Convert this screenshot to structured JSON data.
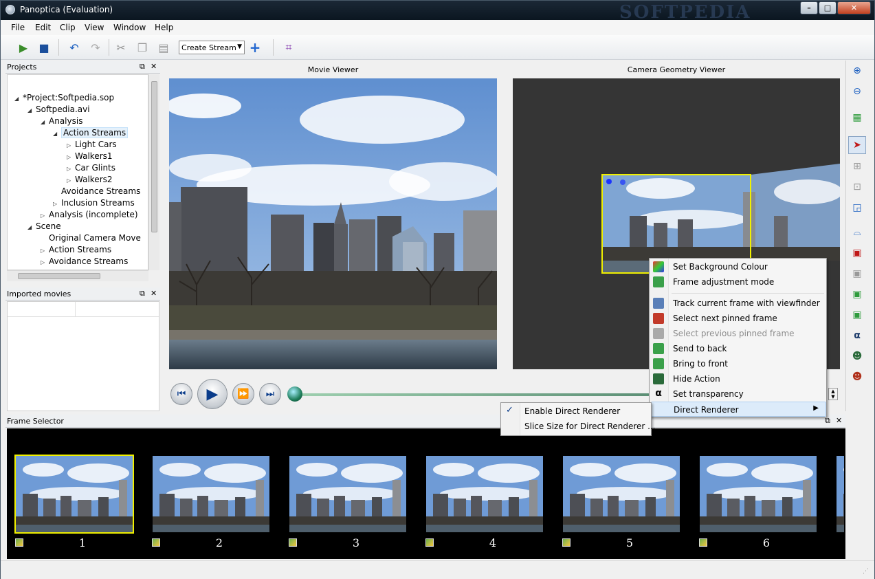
{
  "window": {
    "title": "Panoptica (Evaluation)",
    "watermark": "SOFTPEDIA",
    "min": "–",
    "max": "□",
    "close": "✕"
  },
  "menu": [
    "File",
    "Edit",
    "Clip",
    "View",
    "Window",
    "Help"
  ],
  "toolbar": {
    "stream_select": "Create Stream"
  },
  "projects": {
    "title": "Projects",
    "tree": [
      {
        "label": "*Project:Softpedia.sop",
        "depth": 0,
        "twisty": "◢"
      },
      {
        "label": "Softpedia.avi",
        "depth": 1,
        "twisty": "◢"
      },
      {
        "label": "Analysis",
        "depth": 2,
        "twisty": "◢"
      },
      {
        "label": "Action Streams",
        "depth": 3,
        "twisty": "◢",
        "selected": true
      },
      {
        "label": "Light Cars",
        "depth": 4,
        "twisty": "▷"
      },
      {
        "label": "Walkers1",
        "depth": 4,
        "twisty": "▷"
      },
      {
        "label": "Car Glints",
        "depth": 4,
        "twisty": "▷"
      },
      {
        "label": "Walkers2",
        "depth": 4,
        "twisty": "▷"
      },
      {
        "label": "Avoidance Streams",
        "depth": 3,
        "twisty": ""
      },
      {
        "label": "Inclusion Streams",
        "depth": 3,
        "twisty": "▷"
      },
      {
        "label": "Analysis (incomplete)",
        "depth": 2,
        "twisty": "▷"
      },
      {
        "label": "Scene",
        "depth": 1,
        "twisty": "◢"
      },
      {
        "label": "Original Camera Move",
        "depth": 2,
        "twisty": ""
      },
      {
        "label": "Action Streams",
        "depth": 2,
        "twisty": "▷"
      },
      {
        "label": "Avoidance Streams",
        "depth": 2,
        "twisty": "▷"
      }
    ]
  },
  "imported": {
    "title": "Imported movies"
  },
  "movie_viewer": {
    "title": "Movie Viewer"
  },
  "camera_viewer": {
    "title": "Camera Geometry Viewer"
  },
  "frame_selector": {
    "title": "Frame Selector",
    "frames": [
      "1",
      "2",
      "3",
      "4",
      "5",
      "6"
    ]
  },
  "context_menu": {
    "items": [
      {
        "label": "Set Background Colour",
        "icon": "palette-icon",
        "disabled": false
      },
      {
        "label": "Frame adjustment mode",
        "icon": "frame-adjust-icon",
        "disabled": false
      },
      {
        "label": "Track current frame with viewfinder",
        "icon": "viewfinder-icon",
        "disabled": false
      },
      {
        "label": "Select next pinned frame",
        "icon": "next-pinned-icon",
        "disabled": false
      },
      {
        "label": "Select previous pinned frame",
        "icon": "prev-pinned-icon",
        "disabled": true
      },
      {
        "label": "Send to back",
        "icon": "send-back-icon",
        "disabled": false
      },
      {
        "label": "Bring to front",
        "icon": "bring-front-icon",
        "disabled": false
      },
      {
        "label": "Hide Action",
        "icon": "hide-action-icon",
        "disabled": false
      },
      {
        "label": "Set transparency",
        "icon": "alpha-icon",
        "disabled": false
      },
      {
        "label": "Direct Renderer",
        "icon": "",
        "disabled": false,
        "submenu": true
      }
    ],
    "submenu": [
      {
        "label": "Enable Direct Renderer",
        "checked": true
      },
      {
        "label": "Slice Size for Direct Renderer ...",
        "checked": false
      }
    ]
  },
  "colors": {
    "accent": "#0a3c8a",
    "selection_frame": "#f0f000",
    "viewer_bg": "#353535"
  }
}
